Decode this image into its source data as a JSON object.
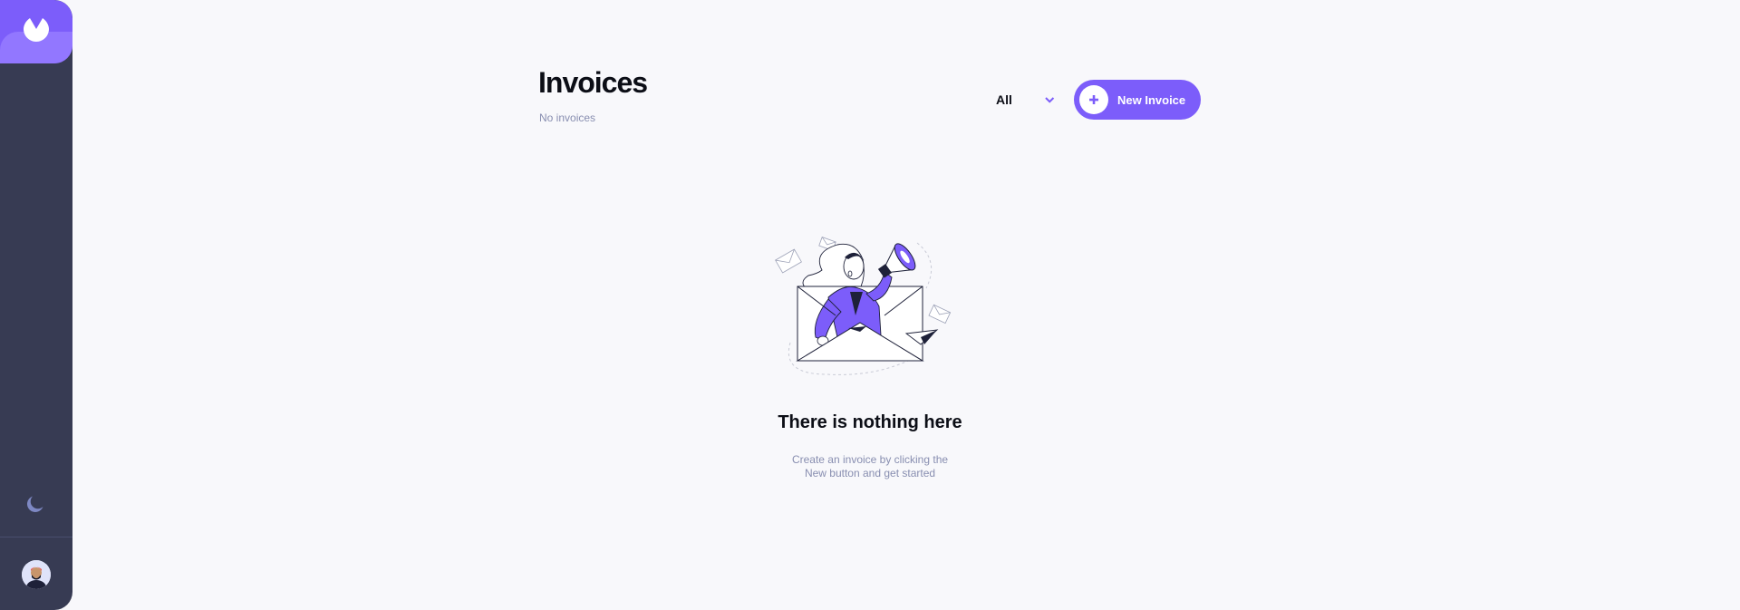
{
  "header": {
    "title": "Invoices",
    "subtitle": "No invoices"
  },
  "filter": {
    "selected": "All",
    "icon": "chevron-down-icon"
  },
  "new_invoice_button": {
    "label": "New Invoice",
    "icon": "plus-icon"
  },
  "empty_state": {
    "title": "There is nothing here",
    "text_line1": "Create an invoice by clicking the",
    "text_line2": "New button and get started",
    "illustration": "woman-with-megaphone-in-envelope-illustration"
  },
  "sidebar": {
    "logo_icon": "logo-icon",
    "theme_toggle_icon": "moon-icon",
    "avatar": "user-avatar"
  },
  "colors": {
    "accent": "#7c5dfa",
    "accent_light": "#9277ff",
    "sidebar": "#373b53",
    "background": "#f8f8fb",
    "text_dark": "#0c0e16",
    "text_muted": "#888eb0"
  }
}
